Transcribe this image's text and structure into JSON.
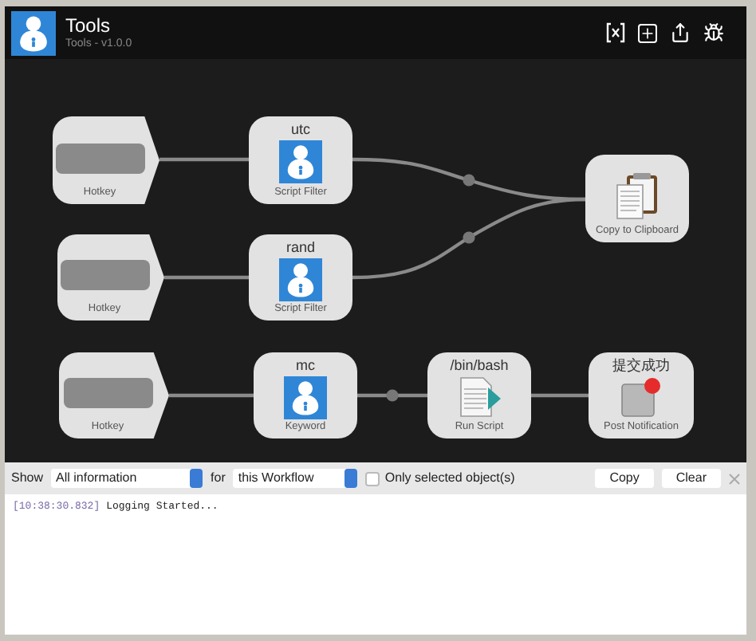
{
  "header": {
    "title": "Tools",
    "subtitle": "Tools - v1.0.0"
  },
  "nodes": [
    {
      "kind": "hotkey",
      "label": "Hotkey"
    },
    {
      "kind": "script_filter",
      "title": "utc",
      "label": "Script Filter"
    },
    {
      "kind": "copy",
      "label": "Copy to Clipboard"
    },
    {
      "kind": "hotkey",
      "label": "Hotkey"
    },
    {
      "kind": "script_filter",
      "title": "rand",
      "label": "Script Filter"
    },
    {
      "kind": "hotkey",
      "label": "Hotkey"
    },
    {
      "kind": "keyword",
      "title": "mc",
      "label": "Keyword"
    },
    {
      "kind": "run_script",
      "title": "/bin/bash",
      "label": "Run Script"
    },
    {
      "kind": "notification",
      "title": "提交成功",
      "label": "Post Notification"
    }
  ],
  "log_bar": {
    "show_label": "Show",
    "show_select": "All information",
    "for_label": "for",
    "for_select": "this Workflow",
    "checkbox": {
      "label": "Only selected object(s)",
      "checked": false
    },
    "buttons": [
      "Copy",
      "Clear"
    ]
  },
  "log_lines": [
    {
      "time": "[10:38:30.832]",
      "message": "Logging Started..."
    }
  ]
}
